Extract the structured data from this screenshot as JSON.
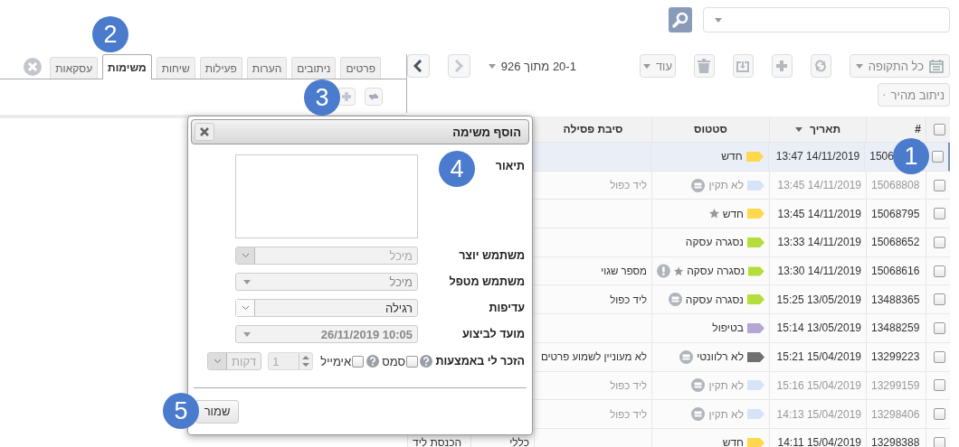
{
  "toolbar": {
    "period": "כל התקופה",
    "more": "עוד",
    "pagination": "20-1 מתוך 926",
    "quick_route": "ניתוב מהיר",
    "nav": [
      {
        "disabled": true
      },
      {
        "disabled": false
      }
    ]
  },
  "tabs": [
    {
      "label": "פרטים",
      "selected": false
    },
    {
      "label": "ניתובים",
      "selected": false
    },
    {
      "label": "הערות",
      "selected": false
    },
    {
      "label": "פעילות",
      "selected": false
    },
    {
      "label": "שיחות",
      "selected": false
    },
    {
      "label": "משימות",
      "selected": true
    },
    {
      "label": "עסקאות",
      "selected": false
    }
  ],
  "table": {
    "all_checked": false,
    "columns": [
      {
        "label": "#",
        "sorted": false
      },
      {
        "label": "תאריך",
        "sorted": true
      },
      {
        "label": "סטטוס",
        "sorted": false
      },
      {
        "label": "סיבת פסילה",
        "sorted": false
      }
    ],
    "rows": [
      {
        "checked": false,
        "selected": true,
        "dimmed": false,
        "id": "1506",
        "date": "13:47 14/11/2019",
        "status": "חדש",
        "color": "#ffd84d",
        "starred": false,
        "alert": false,
        "note": false,
        "reason": ""
      },
      {
        "checked": false,
        "selected": false,
        "dimmed": true,
        "id": "15068808",
        "date": "13:45 14/11/2019",
        "status": "לא תקין",
        "color": "#d6e4f7",
        "starred": false,
        "alert": false,
        "note": true,
        "reason": "ליד כפול"
      },
      {
        "checked": false,
        "selected": false,
        "dimmed": false,
        "id": "15068795",
        "date": "13:45 14/11/2019",
        "status": "חדש",
        "color": "#ffd84d",
        "starred": true,
        "alert": false,
        "note": false,
        "reason": ""
      },
      {
        "checked": false,
        "selected": false,
        "dimmed": false,
        "id": "15068652",
        "date": "13:33 14/11/2019",
        "status": "נסגרה עסקה",
        "color": "#b5dd3c",
        "starred": false,
        "alert": false,
        "note": false,
        "reason": ""
      },
      {
        "checked": false,
        "selected": false,
        "dimmed": false,
        "id": "15068616",
        "date": "13:30 14/11/2019",
        "status": "נסגרה עסקה",
        "color": "#b5dd3c",
        "starred": true,
        "alert": true,
        "note": false,
        "reason": "מספר שגוי"
      },
      {
        "checked": false,
        "selected": false,
        "dimmed": false,
        "id": "13488365",
        "date": "15:25 13/05/2019",
        "status": "נסגרה עסקה",
        "color": "#b5dd3c",
        "starred": false,
        "alert": false,
        "note": true,
        "reason": "ליד כפול"
      },
      {
        "checked": false,
        "selected": false,
        "dimmed": false,
        "id": "13488259",
        "date": "15:14 13/05/2019",
        "status": "בטיפול",
        "color": "#b4a7d6",
        "starred": false,
        "alert": false,
        "note": false,
        "reason": ""
      },
      {
        "checked": false,
        "selected": false,
        "dimmed": false,
        "id": "13299223",
        "date": "15:21 15/04/2019",
        "status": "לא רלוונטי",
        "color": "#707070",
        "starred": false,
        "alert": false,
        "note": true,
        "reason": "לא מעוניין לשמוע פרטים"
      },
      {
        "checked": false,
        "selected": false,
        "dimmed": true,
        "id": "13299159",
        "date": "15:16 15/04/2019",
        "status": "לא תקין",
        "color": "#d6e4f7",
        "starred": false,
        "alert": false,
        "note": true,
        "reason": "ליד כפול"
      },
      {
        "checked": false,
        "selected": false,
        "dimmed": true,
        "id": "13298406",
        "date": "14:13 15/04/2019",
        "status": "לא תקין",
        "color": "#d6e4f7",
        "starred": false,
        "alert": false,
        "note": true,
        "reason": "ליד כפול"
      },
      {
        "checked": false,
        "selected": false,
        "dimmed": false,
        "id": "13298388",
        "date": "14:11 15/04/2019",
        "status": "חדש",
        "color": "#ffd84d",
        "starred": false,
        "alert": false,
        "note": false,
        "reason": "",
        "column_5": "כללי",
        "column_6": "הכנסת ליד"
      }
    ]
  },
  "dialog": {
    "title": "הוסף משימה",
    "fields": [
      {
        "kind": "textarea",
        "label": "תיאור"
      },
      {
        "kind": "select",
        "label": "משתמש יוצר",
        "value": "מיכל",
        "disabled": true
      },
      {
        "kind": "combo",
        "label": "משתמש מטפל",
        "value": "מיכל"
      },
      {
        "kind": "select",
        "label": "עדיפות",
        "value": "רגילה",
        "disabled": false
      },
      {
        "kind": "date",
        "label": "מועד לביצוע",
        "value": "26/11/2019 10:05"
      },
      {
        "kind": "reminder",
        "label": "הזכר לי באמצעות",
        "sms": {
          "label": "סמס",
          "checked": false
        },
        "email": {
          "label": "אימייל",
          "checked": false
        },
        "amount": "1",
        "unit": "דקות"
      }
    ],
    "save": "שמור"
  },
  "callouts": [
    "1",
    "2",
    "3",
    "4",
    "5"
  ]
}
